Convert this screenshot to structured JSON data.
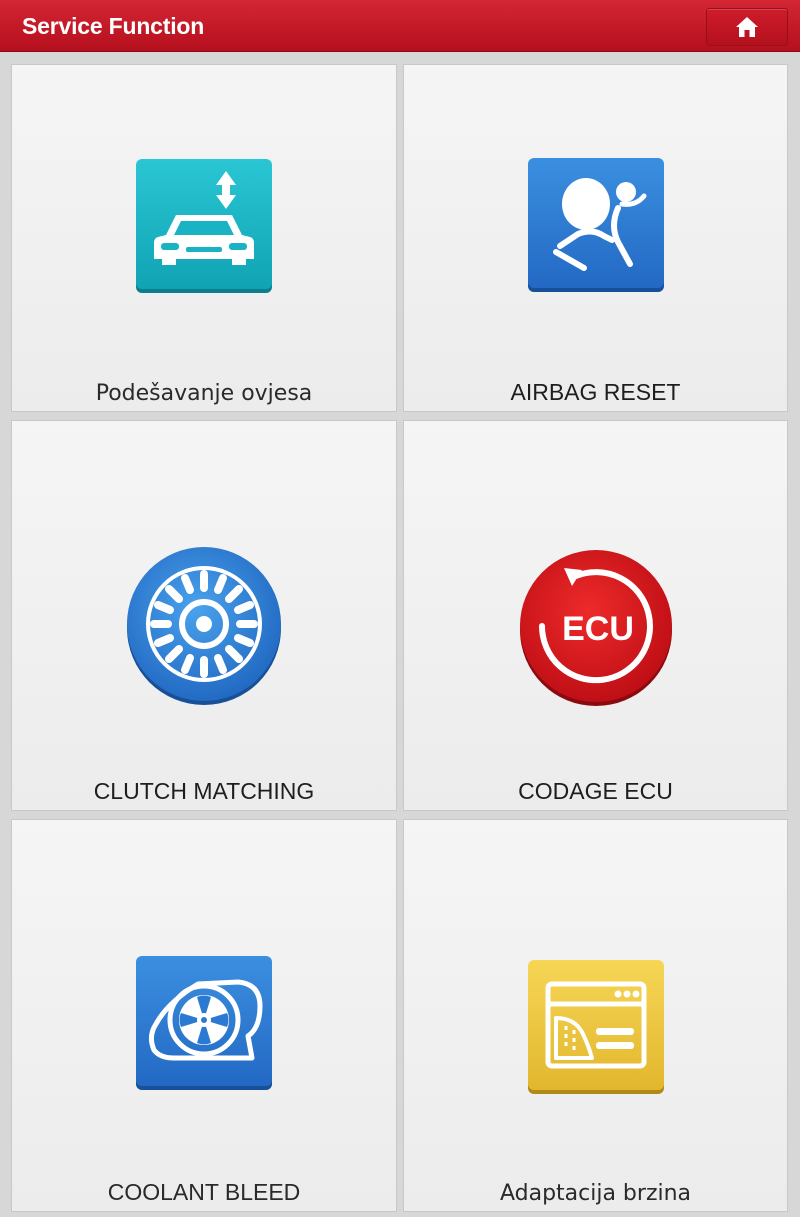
{
  "header": {
    "title": "Service Function"
  },
  "tiles": [
    {
      "label": "Podešavanje ovjesa",
      "icon": "suspension-car-icon",
      "color": "#19b5c4"
    },
    {
      "label": "AIRBAG RESET",
      "icon": "airbag-icon",
      "color": "#2f7fd6"
    },
    {
      "label": "CLUTCH MATCHING",
      "icon": "clutch-disc-icon",
      "color": "#2f7fd6"
    },
    {
      "label": "CODAGE ECU",
      "icon": "ecu-reset-icon",
      "color": "#d8161b",
      "icon_text": "ECU"
    },
    {
      "label": "COOLANT BLEED",
      "icon": "coolant-fan-icon",
      "color": "#2f7fd6"
    },
    {
      "label": "Adaptacija brzina",
      "icon": "throttle-window-icon",
      "color": "#e9c53c"
    }
  ],
  "colors": {
    "header": "#c2192a",
    "tile_background": "#efefef",
    "page_background": "#d7d7d7"
  }
}
